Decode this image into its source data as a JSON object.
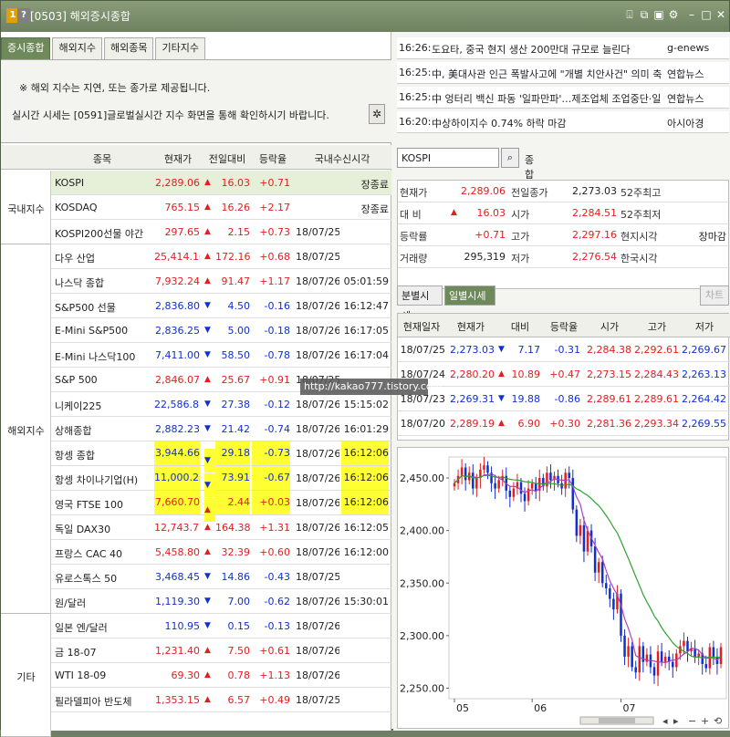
{
  "window": {
    "title": "[0503] 해외증시종합",
    "badge_1": "1",
    "badge_2": "?"
  },
  "tabs": [
    "증시종합",
    "해외지수",
    "해외종목",
    "기타지수"
  ],
  "notice": {
    "line1": "※ 해외 지수는 지연, 또는 종가로 제공됩니다.",
    "line2": "실시간 시세는 [0591]글로벌실시간 지수 화면을 통해 확인하시기 바랍니다."
  },
  "grid": {
    "headers": [
      "종목",
      "현재가",
      "전일대비",
      "등락율",
      "국내수신시각"
    ],
    "groups": [
      {
        "label": "국내지수",
        "rows": 3
      },
      {
        "label": "해외지수",
        "rows": 15
      },
      {
        "label": "기타",
        "rows": 5
      }
    ],
    "rows": [
      {
        "name": "KOSPI",
        "price": "2,289.06",
        "dir": "up",
        "chg": "16.03",
        "pct": "+0.71",
        "date": "",
        "time": "장종료",
        "hl": "kospi"
      },
      {
        "name": "KOSDAQ",
        "price": "765.15",
        "dir": "up",
        "chg": "16.26",
        "pct": "+2.17",
        "date": "",
        "time": "장종료"
      },
      {
        "name": "KOSPI200선물 야간",
        "price": "297.65",
        "dir": "up",
        "chg": "2.15",
        "pct": "+0.73",
        "date": "18/07/25",
        "time": ""
      },
      {
        "name": "다우 산업",
        "price": "25,414.10",
        "dir": "up",
        "chg": "172.16",
        "pct": "+0.68",
        "date": "18/07/25",
        "time": ""
      },
      {
        "name": "나스닥 종합",
        "price": "7,932.24",
        "dir": "up",
        "chg": "91.47",
        "pct": "+1.17",
        "date": "18/07/26",
        "time": "05:01:59"
      },
      {
        "name": "S&P500 선물",
        "price": "2,836.80",
        "dir": "down",
        "chg": "4.50",
        "pct": "-0.16",
        "date": "18/07/26",
        "time": "16:12:47"
      },
      {
        "name": "E-Mini S&P500",
        "price": "2,836.25",
        "dir": "down",
        "chg": "5.00",
        "pct": "-0.18",
        "date": "18/07/26",
        "time": "16:17:05"
      },
      {
        "name": "E-Mini 나스닥100",
        "price": "7,411.00",
        "dir": "down",
        "chg": "58.50",
        "pct": "-0.78",
        "date": "18/07/26",
        "time": "16:17:04"
      },
      {
        "name": "S&P 500",
        "price": "2,846.07",
        "dir": "up",
        "chg": "25.67",
        "pct": "+0.91",
        "date": "18/07/25",
        "time": ""
      },
      {
        "name": "니케이225",
        "price": "22,586.87",
        "dir": "down",
        "chg": "27.38",
        "pct": "-0.12",
        "date": "18/07/26",
        "time": "15:15:02"
      },
      {
        "name": "상해종합",
        "price": "2,882.23",
        "dir": "down",
        "chg": "21.42",
        "pct": "-0.74",
        "date": "18/07/26",
        "time": "16:01:29"
      },
      {
        "name": "항셍 종합",
        "price": "3,944.66",
        "dir": "down",
        "chg": "29.18",
        "pct": "-0.73",
        "date": "18/07/26",
        "time": "16:12:06",
        "hl": "y"
      },
      {
        "name": "항셍 차이나기업(H)",
        "price": "11,000.25",
        "dir": "down",
        "chg": "73.91",
        "pct": "-0.67",
        "date": "18/07/26",
        "time": "16:12:06",
        "hl": "y"
      },
      {
        "name": "영국 FTSE 100",
        "price": "7,660.70",
        "dir": "up",
        "chg": "2.44",
        "pct": "+0.03",
        "date": "18/07/26",
        "time": "16:12:06",
        "hl": "y"
      },
      {
        "name": "독일 DAX30",
        "price": "12,743.71",
        "dir": "up",
        "chg": "164.38",
        "pct": "+1.31",
        "date": "18/07/26",
        "time": "16:12:05"
      },
      {
        "name": "프랑스 CAC 40",
        "price": "5,458.80",
        "dir": "up",
        "chg": "32.39",
        "pct": "+0.60",
        "date": "18/07/26",
        "time": "16:12:00"
      },
      {
        "name": "유로스톡스 50",
        "price": "3,468.45",
        "dir": "down",
        "chg": "14.86",
        "pct": "-0.43",
        "date": "18/07/25",
        "time": ""
      },
      {
        "name": "원/달러",
        "price": "1,119.30",
        "dir": "down",
        "chg": "7.00",
        "pct": "-0.62",
        "date": "18/07/26",
        "time": "15:30:01"
      },
      {
        "name": "일본 엔/달러",
        "price": "110.95",
        "dir": "down",
        "chg": "0.15",
        "pct": "-0.13",
        "date": "18/07/26",
        "time": ""
      },
      {
        "name": "금 18-07",
        "price": "1,231.40",
        "dir": "up",
        "chg": "7.50",
        "pct": "+0.61",
        "date": "18/07/26",
        "time": ""
      },
      {
        "name": "WTI 18-09",
        "price": "69.30",
        "dir": "up",
        "chg": "0.78",
        "pct": "+1.13",
        "date": "18/07/26",
        "time": ""
      },
      {
        "name": "필라델피아 반도체",
        "price": "1,353.15",
        "dir": "up",
        "chg": "6.57",
        "pct": "+0.49",
        "date": "18/07/25",
        "time": ""
      }
    ]
  },
  "watermark": "http://kakao777.tistory.com",
  "news": [
    {
      "time": "16:26:",
      "title": "도요타, 중국 현지 생산 200만대 규모로 늘린다",
      "source": "g-enews"
    },
    {
      "time": "16:25:",
      "title": "中, 美대사관 인근 폭발사고에 \"개별 치안사건\" 의미 축",
      "source": "연합뉴스"
    },
    {
      "time": "16:25:",
      "title": "中 엉터리 백신 파동 '일파만파'…제조업체 조업중단·일",
      "source": "연합뉴스"
    },
    {
      "time": "16:20:",
      "title": "中상하이지수 0.74% 하락 마감",
      "source": "아시아경"
    }
  ],
  "search": {
    "value": "KOSPI",
    "label": "종합"
  },
  "quote": {
    "rows": [
      {
        "k1": "현재가",
        "v1": "2,289.06",
        "k2": "전일종가",
        "v2": "2,273.03",
        "k3": "52주최고",
        "v3": ""
      },
      {
        "k1": "대 비",
        "v1": "16.03",
        "k2": "시가",
        "v2": "2,284.51",
        "k3": "52주최저",
        "v3": ""
      },
      {
        "k1": "등락률",
        "v1": "+0.71",
        "k2": "고가",
        "v2": "2,297.16",
        "k3": "현지시각",
        "v3": "장마감"
      },
      {
        "k1": "거래량",
        "v1": "295,319",
        "k2": "저가",
        "v2": "2,276.54",
        "k3": "한국시각",
        "v3": ""
      }
    ]
  },
  "chart_tabs": {
    "minute": "분별시세",
    "daily": "일별시세",
    "chart_btn": "차트"
  },
  "daily": {
    "headers": [
      "현재일자",
      "현재가",
      "대비",
      "등락율",
      "시가",
      "고가",
      "저가"
    ],
    "rows": [
      {
        "date": "18/07/25",
        "price": "2,273.03",
        "dir": "down",
        "chg": "7.17",
        "pct": "-0.31",
        "open": "2,284.38",
        "high": "2,292.61",
        "low": "2,269.67"
      },
      {
        "date": "18/07/24",
        "price": "2,280.20",
        "dir": "up",
        "chg": "10.89",
        "pct": "+0.47",
        "open": "2,273.15",
        "high": "2,284.43",
        "low": "2,263.13"
      },
      {
        "date": "18/07/23",
        "price": "2,269.31",
        "dir": "down",
        "chg": "19.88",
        "pct": "-0.86",
        "open": "2,289.61",
        "high": "2,289.61",
        "low": "2,264.42"
      },
      {
        "date": "18/07/20",
        "price": "2,289.19",
        "dir": "up",
        "chg": "6.90",
        "pct": "+0.30",
        "open": "2,281.36",
        "high": "2,293.34",
        "low": "2,269.55"
      }
    ]
  },
  "chart_data": {
    "type": "candlestick",
    "title": "",
    "ylim": [
      2240,
      2470
    ],
    "yticks": [
      "2,450.00",
      "2,400.00",
      "2,350.00",
      "2,300.00",
      "2,250.00"
    ],
    "ytick_values": [
      2450,
      2400,
      2350,
      2300,
      2250
    ],
    "xticks": [
      "05",
      "06",
      "07"
    ],
    "xtick_index": [
      0,
      21,
      45
    ],
    "closes": [
      2445,
      2452,
      2460,
      2448,
      2455,
      2440,
      2450,
      2458,
      2462,
      2455,
      2445,
      2440,
      2448,
      2452,
      2438,
      2432,
      2440,
      2446,
      2435,
      2428,
      2440,
      2445,
      2438,
      2450,
      2442,
      2455,
      2448,
      2452,
      2445,
      2440,
      2455,
      2450,
      2420,
      2395,
      2405,
      2380,
      2400,
      2385,
      2360,
      2370,
      2350,
      2345,
      2335,
      2325,
      2340,
      2300,
      2280,
      2290,
      2270,
      2265,
      2290,
      2275,
      2282,
      2270,
      2262,
      2285,
      2275,
      2280,
      2275,
      2270,
      2283,
      2290,
      2295,
      2285,
      2288,
      2280,
      2283,
      2273,
      2269,
      2289,
      2280,
      2273,
      2289
    ],
    "color_up": "#e02020",
    "color_down": "#1030d0",
    "ma_colors": [
      "#b040c0",
      "#30a030"
    ]
  }
}
